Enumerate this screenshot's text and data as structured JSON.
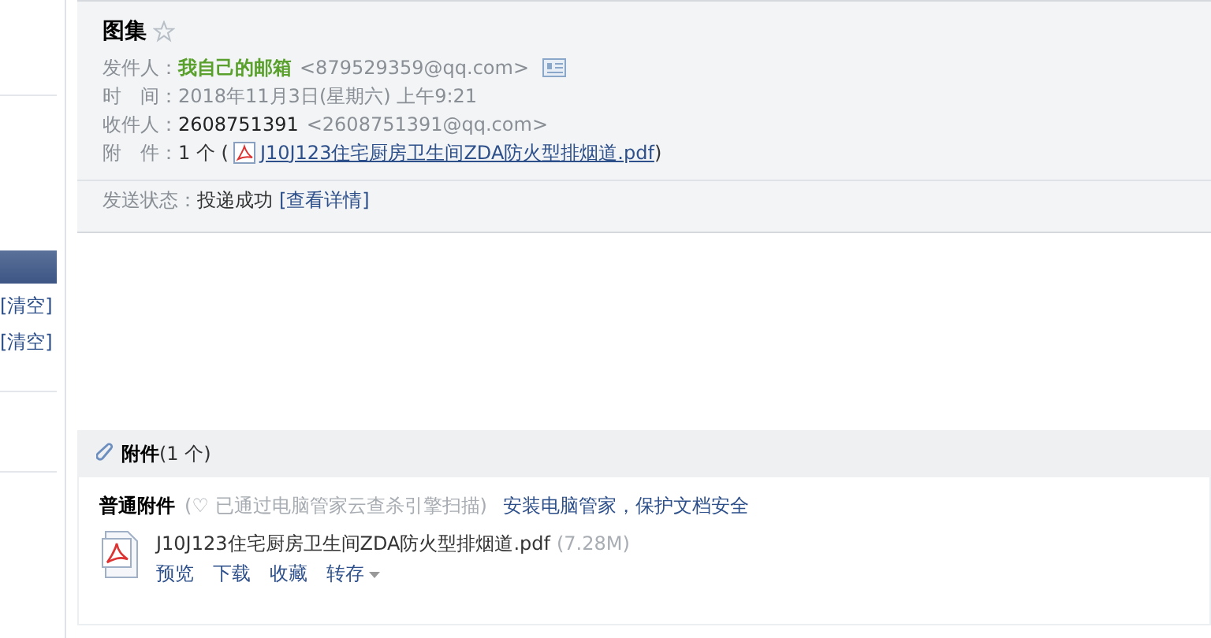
{
  "sidebar": {
    "items": [
      {
        "label": "[清空]"
      },
      {
        "label": "[清空]"
      }
    ]
  },
  "mail": {
    "subject": "图集",
    "starred": false,
    "fields": [
      {
        "label": "发件人：",
        "name": "我自己的邮箱",
        "address": "<879529359@qq.com>",
        "kind": "sender"
      },
      {
        "label": "时　间：",
        "value": "2018年11月3日(星期六) 上午9:21",
        "kind": "plain"
      },
      {
        "label": "收件人：",
        "name": "2608751391",
        "address": "<2608751391@qq.com>",
        "kind": "recipient"
      },
      {
        "label": "附　件：",
        "count": "1 个 (",
        "file": "J10J123住宅厨房卫生间ZDA防火型排烟道.pdf",
        "close": ")",
        "kind": "attachment"
      }
    ],
    "status": {
      "label": "发送状态：",
      "value": "投递成功",
      "link": "[查看详情]"
    }
  },
  "attachments": {
    "title": "附件",
    "count": "(1 个)",
    "section": "普通附件",
    "scan": "(♡ 已通过电脑管家云查杀引擎扫描)",
    "promo": "安装电脑管家，保护文档安全",
    "files": [
      {
        "name": "J10J123住宅厨房卫生间ZDA防火型排烟道.pdf",
        "size": "(7.28M)",
        "actions": [
          "预览",
          "下载",
          "收藏",
          "转存"
        ]
      }
    ]
  }
}
